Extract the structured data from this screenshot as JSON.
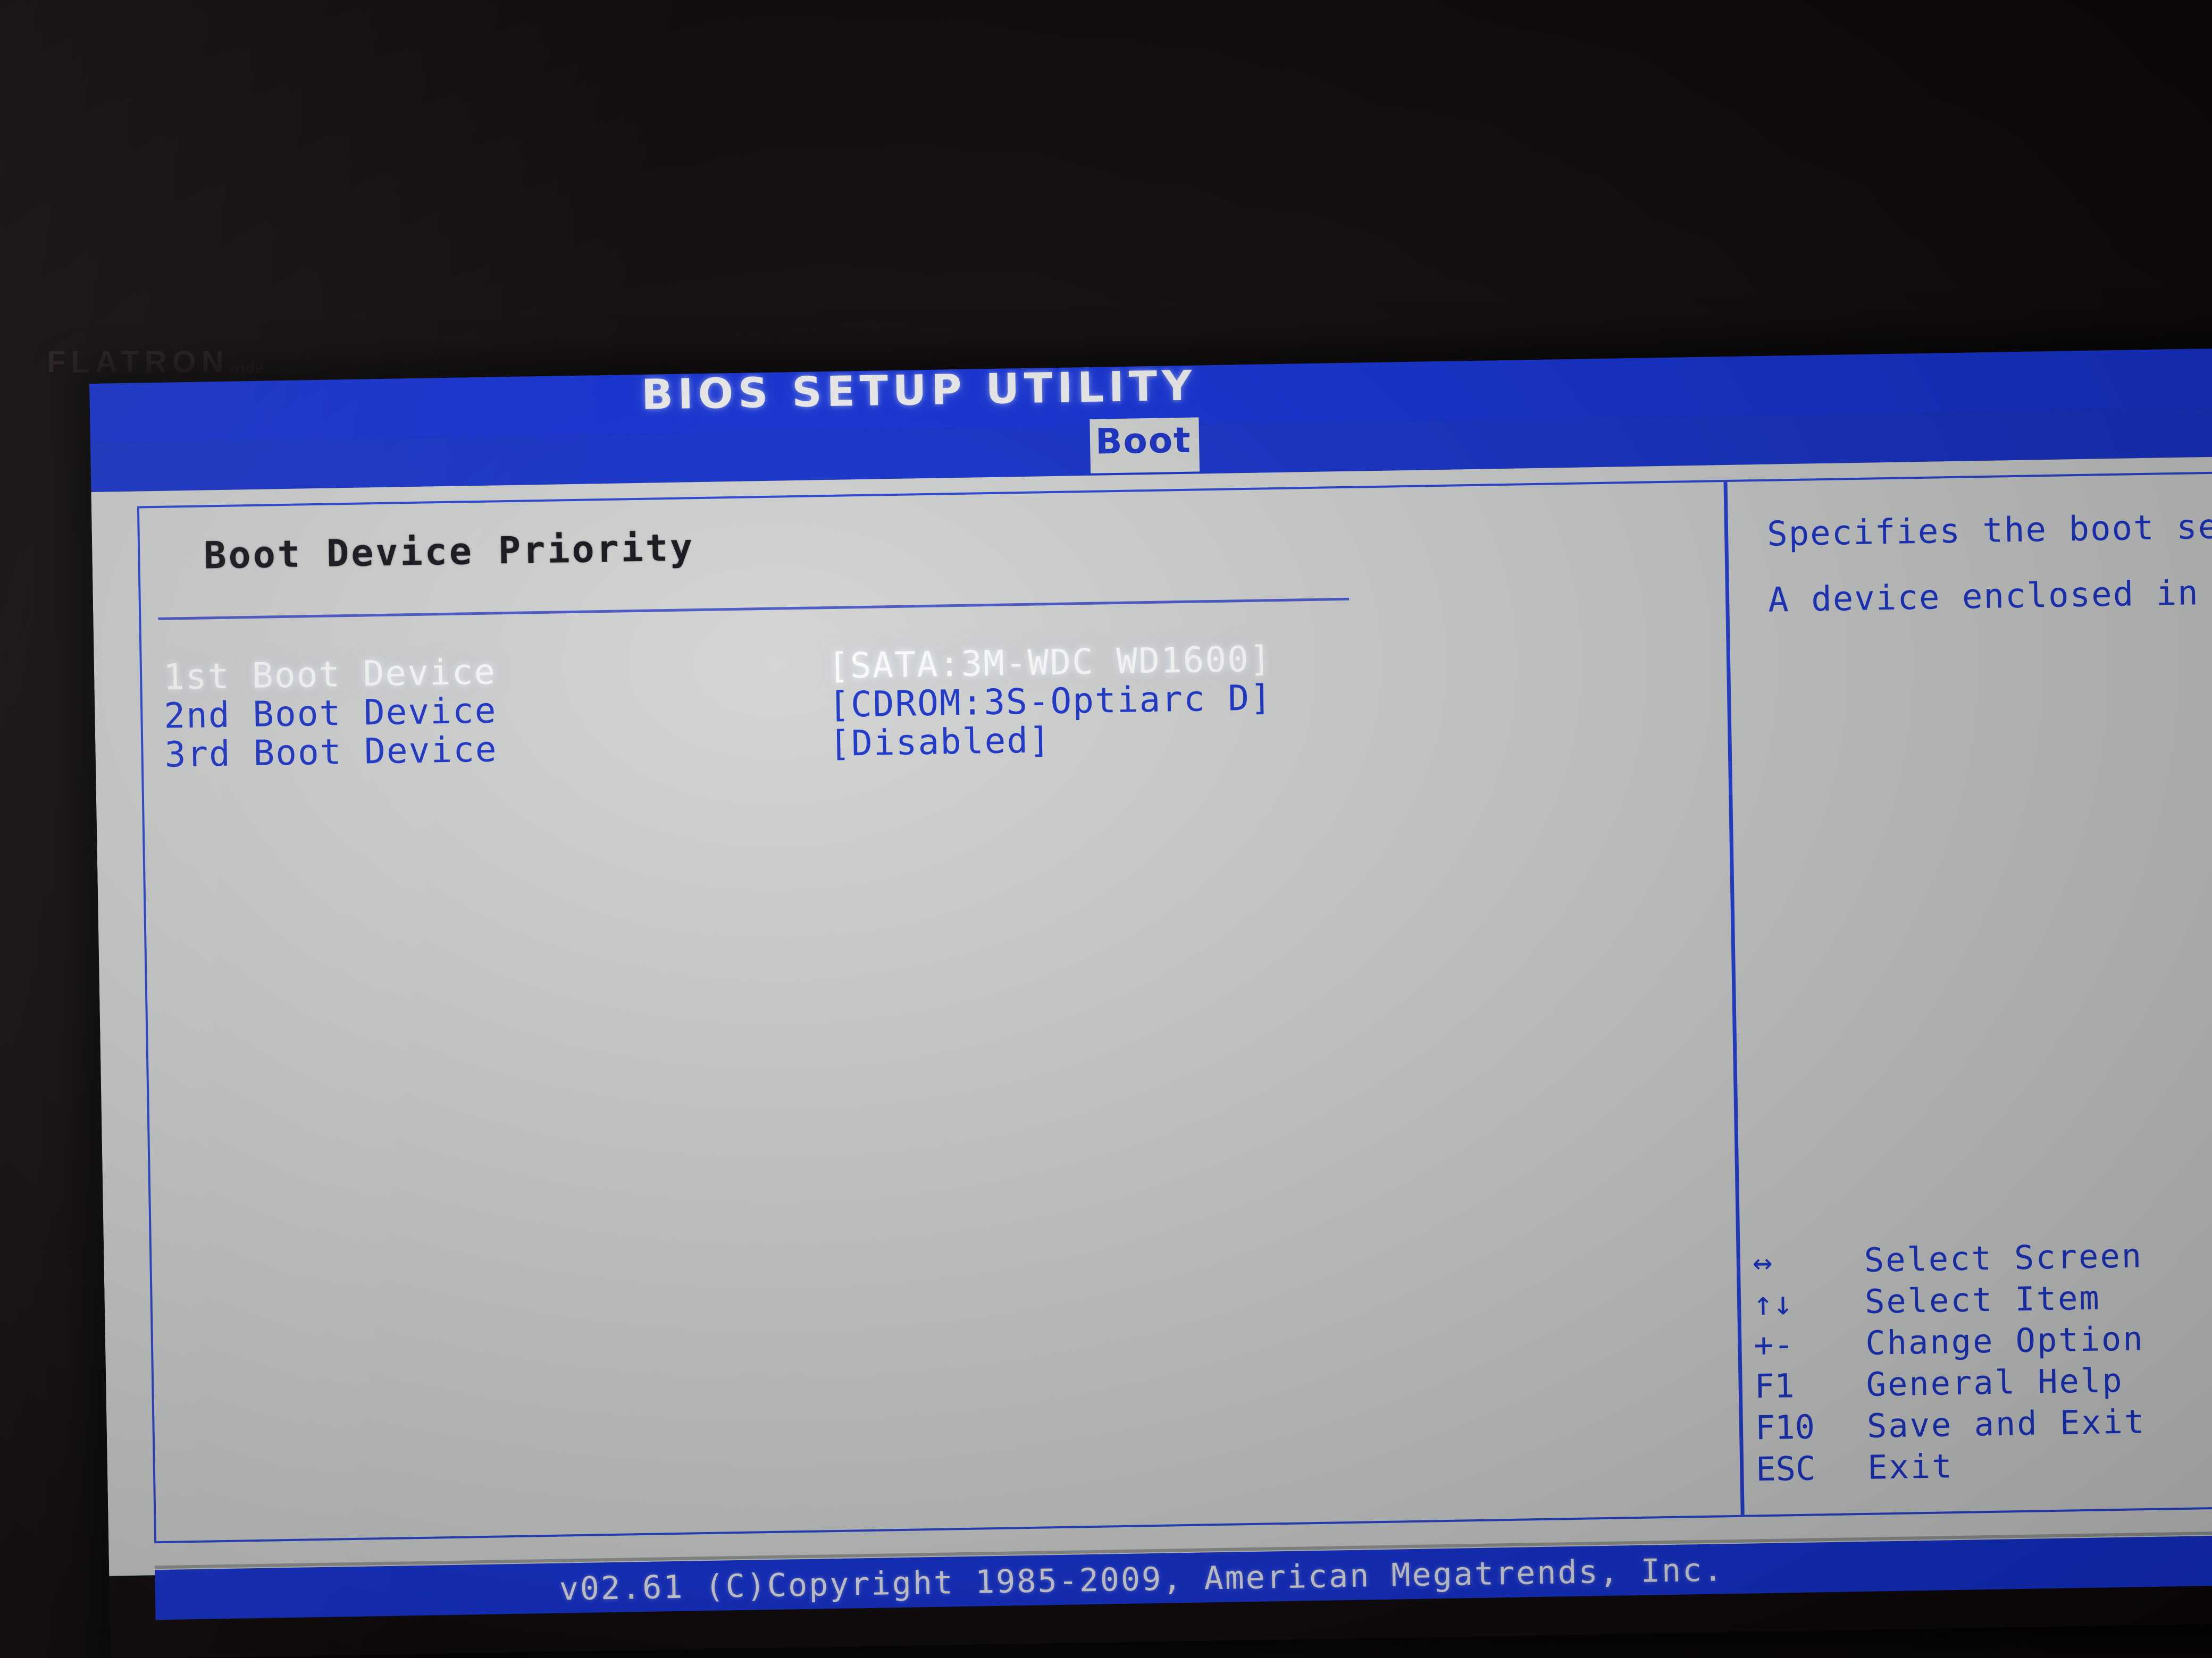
{
  "monitor": {
    "brand": "FLATRON",
    "brand_sub": "wide"
  },
  "header": {
    "title": "BIOS SETUP UTILITY",
    "active_tab": "Boot"
  },
  "main": {
    "section_heading": "Boot Device Priority",
    "rows": [
      {
        "label": "1st Boot Device",
        "value": "[SATA:3M-WDC WD1600]",
        "selected": true
      },
      {
        "label": "2nd Boot Device",
        "value": "[CDROM:3S-Optiarc D]",
        "selected": false
      },
      {
        "label": "3rd Boot Device",
        "value": "[Disabled]",
        "selected": false
      }
    ]
  },
  "help": {
    "paragraph1": "Specifies the boot sequence from the available devices.",
    "paragraph2": "A device enclosed in parenthesis has been disabled in the corresponding type menu ."
  },
  "keys": [
    {
      "key": "↔",
      "desc": "Select Screen"
    },
    {
      "key": "↑↓",
      "desc": "Select Item"
    },
    {
      "key": "+-",
      "desc": "Change Option"
    },
    {
      "key": "F1",
      "desc": "General Help"
    },
    {
      "key": "F10",
      "desc": "Save and Exit"
    },
    {
      "key": "ESC",
      "desc": "Exit"
    }
  ],
  "footer": {
    "text": "v02.61 (C)Copyright 1985-2009, American Megatrends, Inc."
  },
  "colors": {
    "blue_title": "#1533d8",
    "blue_menu": "#1734cf",
    "panel_bg": "#d2d4d3",
    "text_blue": "#1b35cc",
    "text_black": "#14161c",
    "text_white": "#fdfdfd"
  }
}
